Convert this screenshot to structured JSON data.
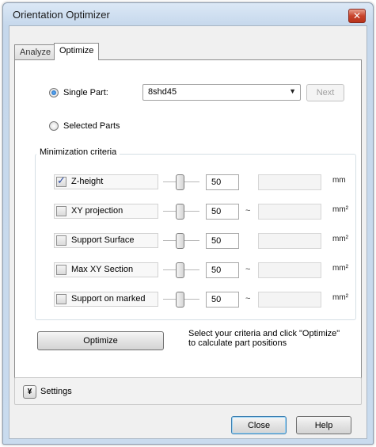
{
  "window": {
    "title": "Orientation Optimizer",
    "close_glyph": "✕"
  },
  "tabs": [
    {
      "label": "Analyze",
      "active": false
    },
    {
      "label": "Optimize",
      "active": true
    }
  ],
  "part_selection": {
    "single_part_label": "Single Part:",
    "single_part_checked": true,
    "part_value": "8shd45",
    "next_label": "Next",
    "selected_parts_label": "Selected Parts",
    "selected_parts_checked": false
  },
  "criteria": {
    "group_label": "Minimization criteria",
    "rows": [
      {
        "label": "Z-height",
        "checked": true,
        "value": "50",
        "tilde": "",
        "unit": "mm"
      },
      {
        "label": "XY projection",
        "checked": false,
        "value": "50",
        "tilde": "~",
        "unit": "mm²"
      },
      {
        "label": "Support Surface",
        "checked": false,
        "value": "50",
        "tilde": "",
        "unit": "mm²"
      },
      {
        "label": "Max XY Section",
        "checked": false,
        "value": "50",
        "tilde": "~",
        "unit": "mm²"
      },
      {
        "label": "Support on marked",
        "checked": false,
        "value": "50",
        "tilde": "~",
        "unit": "mm²"
      }
    ]
  },
  "optimize": {
    "button_label": "Optimize",
    "hint_line1": "Select your criteria and click \"Optimize\"",
    "hint_line2": "to calculate part positions"
  },
  "settings": {
    "label": "Settings",
    "toggle_glyph": "¥"
  },
  "footer": {
    "close_label": "Close",
    "help_label": "Help"
  },
  "icons": {
    "close": "close-icon",
    "dropdown": "chevron-down-icon",
    "expand": "double-chevron-down-icon"
  },
  "colors": {
    "title_bar": "#c6d8ec",
    "close_button": "#c8442c",
    "check_mark": "#2b4aa2",
    "default_button_border": "#3c7fb1"
  }
}
